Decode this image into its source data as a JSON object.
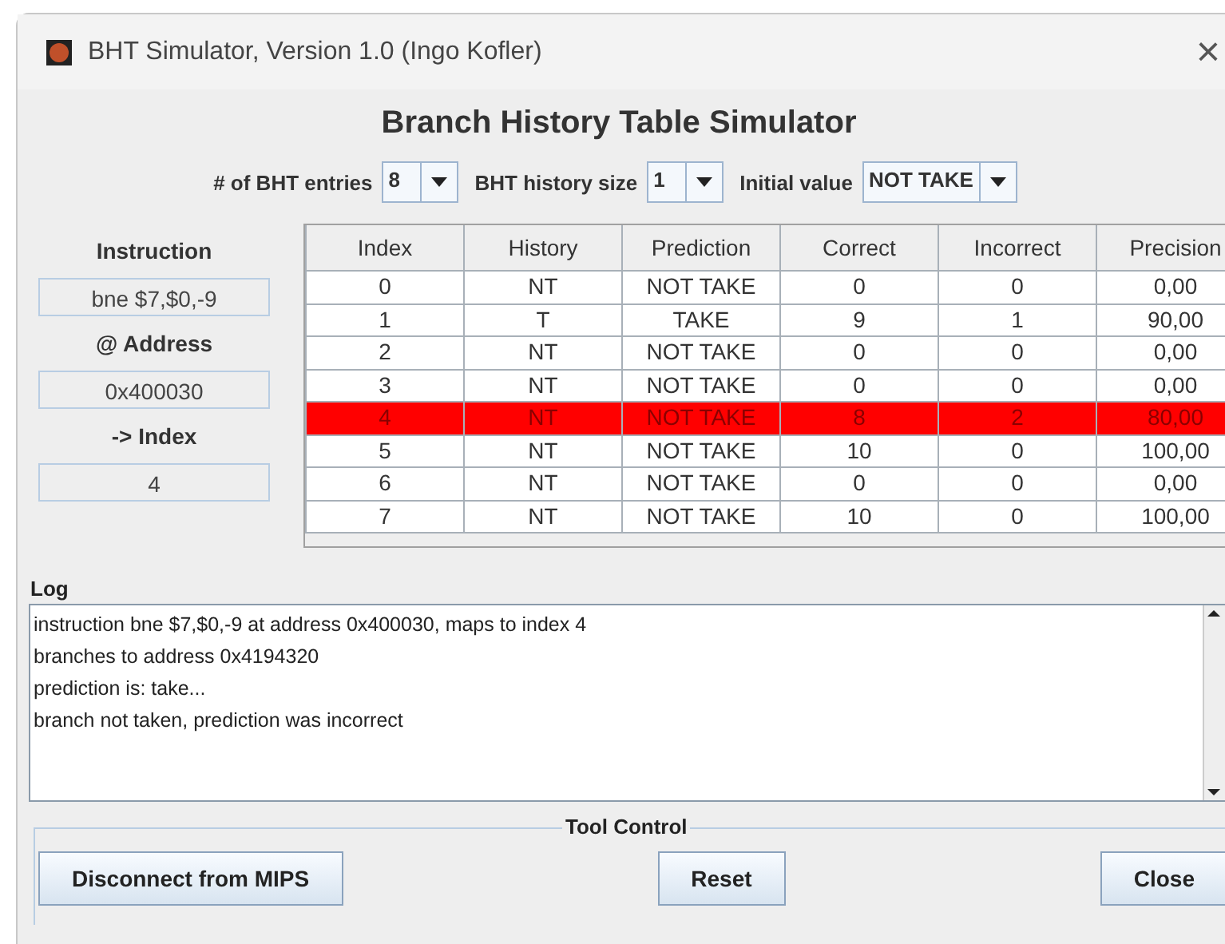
{
  "window": {
    "title": "BHT Simulator, Version 1.0 (Ingo Kofler)",
    "close": "×"
  },
  "heading": "Branch History Table Simulator",
  "settings": [
    {
      "label": "# of BHT entries",
      "value": "8"
    },
    {
      "label": "BHT history size",
      "value": "1"
    },
    {
      "label": "Initial value",
      "value": "NOT TAKE"
    }
  ],
  "instruction_panel": [
    {
      "label": "Instruction",
      "value": "bne $7,$0,-9"
    },
    {
      "label": "@ Address",
      "value": "0x400030"
    },
    {
      "label": "-> Index",
      "value": "4"
    }
  ],
  "table": {
    "columns": [
      "Index",
      "History",
      "Prediction",
      "Correct",
      "Incorrect",
      "Precision"
    ],
    "rows": [
      {
        "cells": [
          "0",
          "NT",
          "NOT TAKE",
          "0",
          "0",
          "0,00"
        ],
        "selected": false
      },
      {
        "cells": [
          "1",
          "T",
          "TAKE",
          "9",
          "1",
          "90,00"
        ],
        "selected": false
      },
      {
        "cells": [
          "2",
          "NT",
          "NOT TAKE",
          "0",
          "0",
          "0,00"
        ],
        "selected": false
      },
      {
        "cells": [
          "3",
          "NT",
          "NOT TAKE",
          "0",
          "0",
          "0,00"
        ],
        "selected": false
      },
      {
        "cells": [
          "4",
          "NT",
          "NOT TAKE",
          "8",
          "2",
          "80,00"
        ],
        "selected": true
      },
      {
        "cells": [
          "5",
          "NT",
          "NOT TAKE",
          "10",
          "0",
          "100,00"
        ],
        "selected": false
      },
      {
        "cells": [
          "6",
          "NT",
          "NOT TAKE",
          "0",
          "0",
          "0,00"
        ],
        "selected": false
      },
      {
        "cells": [
          "7",
          "NT",
          "NOT TAKE",
          "10",
          "0",
          "100,00"
        ],
        "selected": false
      }
    ]
  },
  "log": {
    "label": "Log",
    "lines": [
      "instruction bne $7,$0,-9 at address 0x400030, maps to index 4",
      "branches to address 0x4194320",
      "prediction is: take...",
      "branch not taken, prediction was incorrect"
    ]
  },
  "tool_control": {
    "title": "Tool Control",
    "buttons": [
      "Disconnect from MIPS",
      "Reset",
      "Close"
    ]
  }
}
